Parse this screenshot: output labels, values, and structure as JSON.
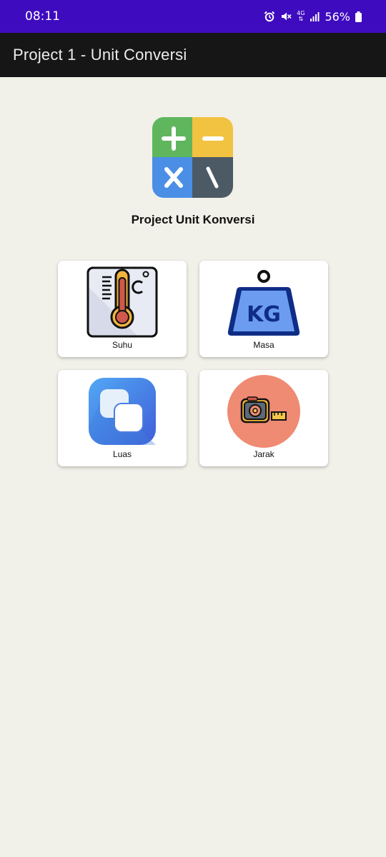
{
  "status_bar": {
    "time": "08:11",
    "network": "4G",
    "battery": "56%",
    "icons": [
      "alarm-icon",
      "mute-icon",
      "signal-icon",
      "battery-icon"
    ]
  },
  "app_bar": {
    "title": "Project 1 - Unit Conversi"
  },
  "main": {
    "logo_icon": "calculator-icon",
    "heading": "Project Unit Konversi",
    "menu": [
      {
        "label": "Suhu",
        "icon": "thermometer-icon"
      },
      {
        "label": "Masa",
        "icon": "weight-kg-icon",
        "icon_text": "KG"
      },
      {
        "label": "Luas",
        "icon": "area-squares-icon"
      },
      {
        "label": "Jarak",
        "icon": "measuring-tape-icon"
      }
    ]
  },
  "colors": {
    "status_bar": "#3f0bbf",
    "app_bar": "#161616",
    "background": "#f1f0e9",
    "card": "#ffffff"
  }
}
